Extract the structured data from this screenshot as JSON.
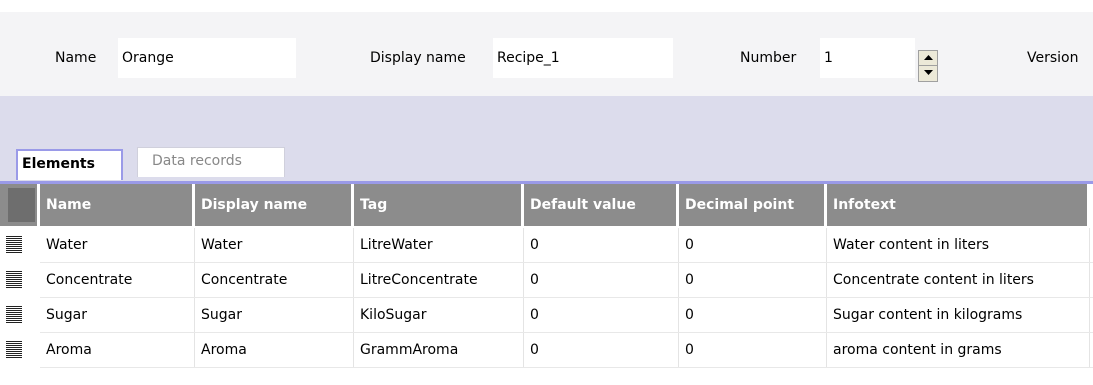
{
  "properties": {
    "name_label": "Name",
    "name_value": "Orange",
    "display_name_label": "Display name",
    "display_name_value": "Recipe_1",
    "number_label": "Number",
    "number_value": "1",
    "version_label": "Version"
  },
  "tabs": {
    "elements": "Elements",
    "data_records": "Data records"
  },
  "table": {
    "columns": [
      "Name",
      "Display name",
      "Tag",
      "Default value",
      "Decimal point",
      "Infotext"
    ],
    "rows": [
      [
        "Water",
        "Water",
        "LitreWater",
        "0",
        "0",
        "Water content in liters"
      ],
      [
        "Concentrate",
        "Concentrate",
        "LitreConcentrate",
        "0",
        "0",
        "Concentrate content in liters"
      ],
      [
        "Sugar",
        "Sugar",
        "KiloSugar",
        "0",
        "0",
        "Sugar content in kilograms"
      ],
      [
        "Aroma",
        "Aroma",
        "GrammAroma",
        "0",
        "0",
        "aroma content in grams"
      ]
    ]
  },
  "icons": {
    "row_handle": "row-handle-icon",
    "spin_up": "arrow-up-icon",
    "spin_down": "arrow-down-icon"
  },
  "colors": {
    "header_bg": "#8c8c8c",
    "tab_accent": "#9a9ae8",
    "band_bg": "#dcdcec"
  }
}
